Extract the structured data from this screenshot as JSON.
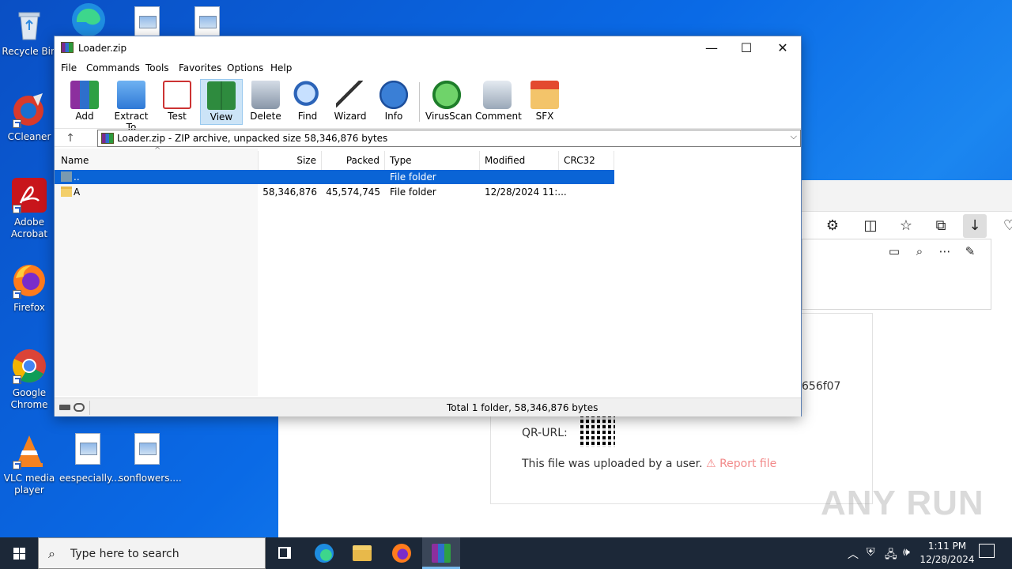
{
  "desktop": {
    "icons": [
      {
        "label": "Recycle Bin",
        "icon": "recycle-bin-icon"
      },
      {
        "label": "CCleaner",
        "icon": "ccleaner-icon"
      },
      {
        "label": "Adobe Acrobat",
        "icon": "adobe-acrobat-icon"
      },
      {
        "label": "Firefox",
        "icon": "firefox-icon"
      },
      {
        "label": "Google Chrome",
        "icon": "chrome-icon"
      },
      {
        "label": "VLC media player",
        "icon": "vlc-icon"
      },
      {
        "label": "eespecially...",
        "icon": "image-file-icon"
      },
      {
        "label": "sonflowers....",
        "icon": "image-file-icon"
      }
    ]
  },
  "browser": {
    "hash_fragment": "656f07",
    "qr_label": "QR-URL:",
    "upload_text": "This file was uploaded by a user.",
    "report_link": "Report file",
    "watermark": "ANY RUN"
  },
  "winrar": {
    "title": "Loader.zip",
    "menu": [
      "File",
      "Commands",
      "Tools",
      "Favorites",
      "Options",
      "Help"
    ],
    "toolbar": [
      {
        "label": "Add",
        "icon": "add-archive-icon"
      },
      {
        "label": "Extract To",
        "icon": "extract-folder-icon"
      },
      {
        "label": "Test",
        "icon": "test-clipboard-icon"
      },
      {
        "label": "View",
        "icon": "view-book-icon",
        "active": true
      },
      {
        "label": "Delete",
        "icon": "trash-icon"
      },
      {
        "label": "Find",
        "icon": "find-magnifier-icon"
      },
      {
        "label": "Wizard",
        "icon": "wizard-wand-icon"
      },
      {
        "label": "Info",
        "icon": "info-icon"
      },
      {
        "label": "VirusScan",
        "icon": "virus-scan-icon"
      },
      {
        "label": "Comment",
        "icon": "comment-icon"
      },
      {
        "label": "SFX",
        "icon": "sfx-icon"
      }
    ],
    "path": "Loader.zip - ZIP archive, unpacked size 58,346,876 bytes",
    "columns": {
      "name": "Name",
      "size": "Size",
      "packed": "Packed",
      "type": "Type",
      "modified": "Modified",
      "crc": "CRC32"
    },
    "rows": [
      {
        "name": "..",
        "size": "",
        "packed": "",
        "type": "File folder",
        "modified": "",
        "selected": true
      },
      {
        "name": "A",
        "size": "58,346,876",
        "packed": "45,574,745",
        "type": "File folder",
        "modified": "12/28/2024 11:..."
      }
    ],
    "status": "Total 1 folder, 58,346,876 bytes"
  },
  "taskbar": {
    "search_placeholder": "Type here to search",
    "time": "1:11 PM",
    "date": "12/28/2024"
  },
  "colors": {
    "selection": "#0a64d6",
    "desktop": "#0a6ae6",
    "taskbar": "#1c2838"
  }
}
